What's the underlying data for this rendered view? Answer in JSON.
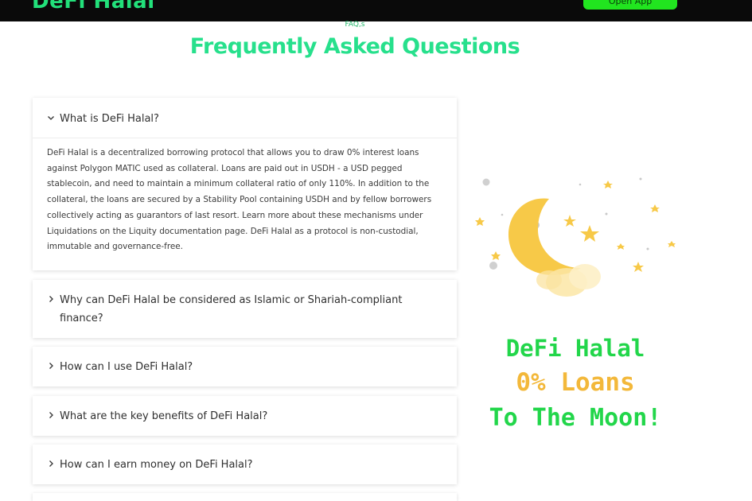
{
  "header": {
    "logo": "DeFi Halal",
    "app_button": "Open App"
  },
  "faq": {
    "eyebrow": "FAQ,s",
    "title": "Frequently Asked Questions",
    "items": [
      {
        "question": "What is DeFi Halal?",
        "expanded": true,
        "answer": "DeFi Halal is a decentralized borrowing protocol that allows you to draw 0% interest loans against Polygon MATIC used as collateral. Loans are paid out in USDH - a USD pegged stablecoin, and need to maintain a minimum collateral ratio of only 110%. In addition to the collateral, the loans are secured by a Stability Pool containing USDH and by fellow borrowers collectively acting as guarantors of last resort. Learn more about these mechanisms under Liquidations on the Liquity documentation page. DeFi Halal as a protocol is non-custodial, immutable and governance-free."
      },
      {
        "question": "Why can DeFi Halal be considered as Islamic or Shariah-compliant finance?",
        "expanded": false
      },
      {
        "question": "How can I use DeFi Halal?",
        "expanded": false
      },
      {
        "question": "What are the key benefits of DeFi Halal?",
        "expanded": false
      },
      {
        "question": "How can I earn money on DeFi Halal?",
        "expanded": false
      }
    ]
  },
  "icons": {
    "expanded": "chevron-down-icon",
    "collapsed": "chevron-right-icon",
    "illustration": "moon-stars-icon"
  },
  "promo": {
    "line1": "DeFi Halal",
    "line2": "0% Loans",
    "line3": "To The Moon!"
  },
  "colors": {
    "title_green": "#27e08c",
    "promo_green": "#22d64a",
    "promo_gold": "#f3b83a",
    "button_green": "#21e51f"
  }
}
